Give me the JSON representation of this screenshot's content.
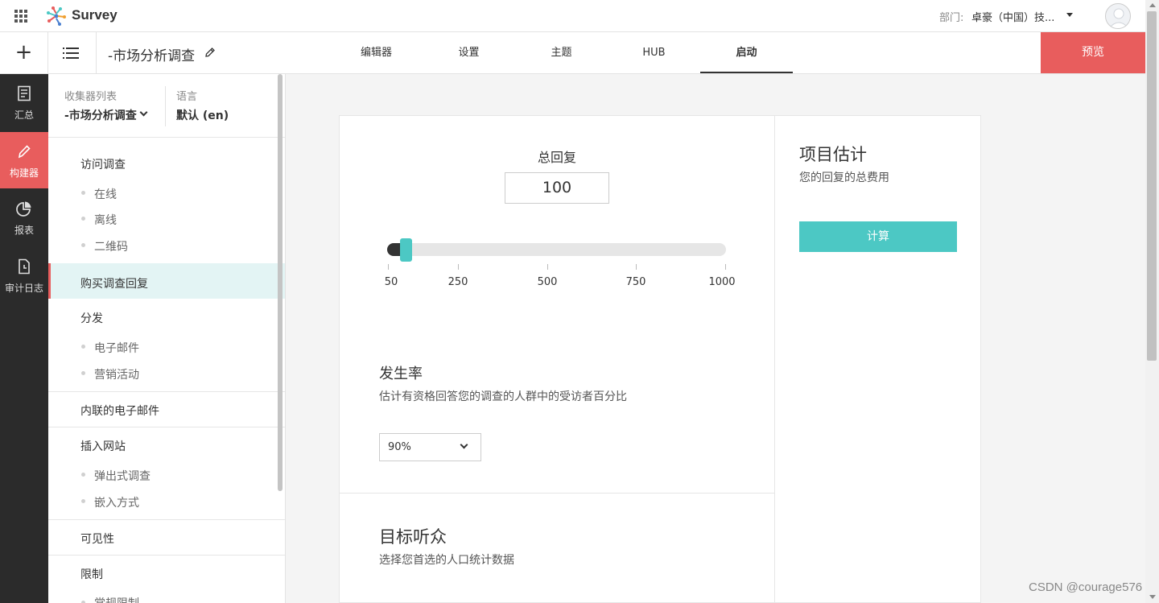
{
  "header": {
    "brand": "Survey",
    "department_label": "部门:",
    "department_value": "卓豪（中国）技...",
    "brand_colors": [
      "#e85d5d",
      "#4cc8c4",
      "#f0a030",
      "#4a7fd0"
    ]
  },
  "toolbar": {
    "add_icon": "+",
    "survey_title": "-市场分析调查",
    "tabs": [
      {
        "label": "编辑器",
        "active": false
      },
      {
        "label": "设置",
        "active": false
      },
      {
        "label": "主题",
        "active": false
      },
      {
        "label": "HUB",
        "active": false
      },
      {
        "label": "启动",
        "active": true
      }
    ],
    "preview_label": "预览"
  },
  "leftnav": {
    "items": [
      {
        "label": "汇总",
        "icon": "document-icon",
        "active": false
      },
      {
        "label": "构建器",
        "icon": "pencil-icon",
        "active": true
      },
      {
        "label": "报表",
        "icon": "pie-chart-icon",
        "active": false
      },
      {
        "label": "审计日志",
        "icon": "log-file-icon",
        "active": false
      }
    ]
  },
  "sidepanel": {
    "collector_label": "收集器列表",
    "collector_value": "-市场分析调查",
    "language_label": "语言",
    "language_value": "默认 (en)",
    "sections": [
      {
        "label": "访问调查",
        "items": [
          "在线",
          "离线",
          "二维码"
        ]
      },
      {
        "label": "购买调查回复",
        "active": true,
        "items": []
      },
      {
        "label": "分发",
        "items": [
          "电子邮件",
          "营销活动"
        ]
      },
      {
        "label": "内联的电子邮件",
        "items": []
      },
      {
        "label": "插入网站",
        "items": [
          "弹出式调查",
          "嵌入方式"
        ]
      },
      {
        "label": "可见性",
        "items": []
      },
      {
        "label": "限制",
        "items": [
          "常规限制"
        ]
      }
    ]
  },
  "main": {
    "total_label": "总回复",
    "total_value": "100",
    "slider": {
      "min": 50,
      "max": 1000,
      "value": 100,
      "ticks": [
        "50",
        "250",
        "500",
        "750",
        "1000"
      ]
    },
    "rate_title": "发生率",
    "rate_desc": "估计有资格回答您的调查的人群中的受访者百分比",
    "rate_value": "90%",
    "audience_title": "目标听众",
    "audience_desc": "选择您首选的人口统计数据"
  },
  "estimate": {
    "title": "项目估计",
    "desc": "您的回复的总费用",
    "button_label": "计算"
  },
  "watermark": "CSDN @courage576"
}
